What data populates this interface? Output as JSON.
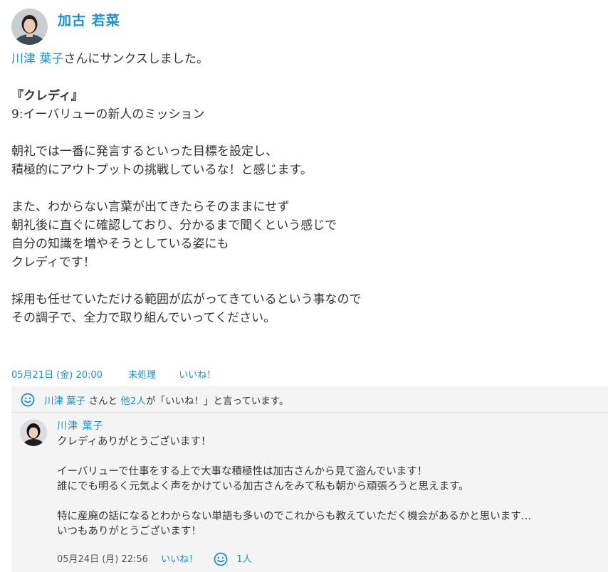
{
  "post": {
    "author": "加古 若菜",
    "thanks_target": "川津 葉子",
    "thanks_suffix": "さんにサンクスしました。",
    "tag": "『クレディ』",
    "lines": [
      "9:イーバリューの新人のミッション",
      "",
      "朝礼では一番に発言するといった目標を設定し、",
      "積極的にアウトプットの挑戦しているな！と感じます。",
      "",
      "また、わからない言葉が出てきたらそのままにせず",
      "朝礼後に直ぐに確認しており、分かるまで聞くという感じで",
      "自分の知識を増やそうとしている姿にも",
      "クレディです！",
      "",
      "採用も任せていただける範囲が広がってきているという事なので",
      "その調子で、全力で取り組んでいってください。"
    ],
    "date": "05月21日 (金) 20:00",
    "status_link": "未処理",
    "like_link": "いいね！"
  },
  "likes": {
    "user": "川津 葉子",
    "mid": " さんと ",
    "others": "他2人",
    "suffix": "が「いいね！」と言っています。",
    "icon": "smile-icon"
  },
  "reply": {
    "author": "川津 葉子",
    "lines": [
      "クレディありがとうございます！",
      "",
      "イーバリューで仕事をする上で大事な積極性は加古さんから見て盗んでいます！",
      "誰にでも明るく元気よく声をかけている加古さんをみて私も朝から頑張ろうと思えます。",
      "",
      "特に産廃の話になるとわからない単語も多いのでこれからも教えていただく機会があるかと思います…",
      "いつもありがとうございます！"
    ],
    "date": "05月24日 (月) 22:56",
    "like_link": "いいね！",
    "like_count": "1人"
  },
  "colors": {
    "link": "#1a8fd1",
    "text": "#333333",
    "reply_bg": "#f4f4f4"
  }
}
